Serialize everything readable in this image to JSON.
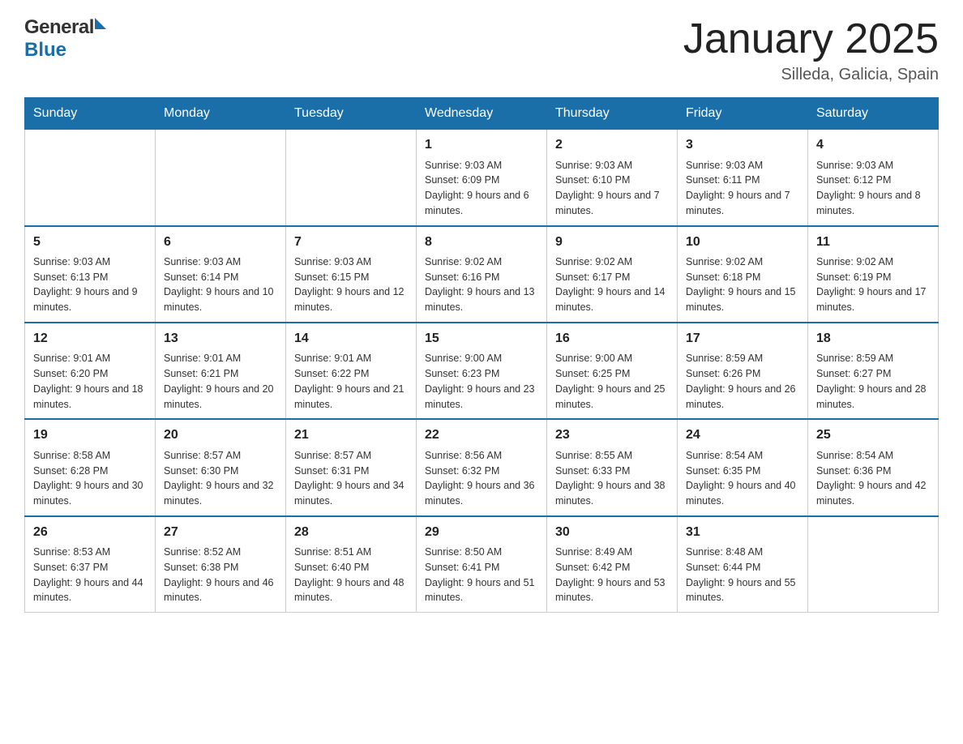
{
  "header": {
    "logo_general": "General",
    "logo_blue": "Blue",
    "month_title": "January 2025",
    "location": "Silleda, Galicia, Spain"
  },
  "days_of_week": [
    "Sunday",
    "Monday",
    "Tuesday",
    "Wednesday",
    "Thursday",
    "Friday",
    "Saturday"
  ],
  "weeks": [
    [
      {
        "day": "",
        "info": ""
      },
      {
        "day": "",
        "info": ""
      },
      {
        "day": "",
        "info": ""
      },
      {
        "day": "1",
        "info": "Sunrise: 9:03 AM\nSunset: 6:09 PM\nDaylight: 9 hours and 6 minutes."
      },
      {
        "day": "2",
        "info": "Sunrise: 9:03 AM\nSunset: 6:10 PM\nDaylight: 9 hours and 7 minutes."
      },
      {
        "day": "3",
        "info": "Sunrise: 9:03 AM\nSunset: 6:11 PM\nDaylight: 9 hours and 7 minutes."
      },
      {
        "day": "4",
        "info": "Sunrise: 9:03 AM\nSunset: 6:12 PM\nDaylight: 9 hours and 8 minutes."
      }
    ],
    [
      {
        "day": "5",
        "info": "Sunrise: 9:03 AM\nSunset: 6:13 PM\nDaylight: 9 hours and 9 minutes."
      },
      {
        "day": "6",
        "info": "Sunrise: 9:03 AM\nSunset: 6:14 PM\nDaylight: 9 hours and 10 minutes."
      },
      {
        "day": "7",
        "info": "Sunrise: 9:03 AM\nSunset: 6:15 PM\nDaylight: 9 hours and 12 minutes."
      },
      {
        "day": "8",
        "info": "Sunrise: 9:02 AM\nSunset: 6:16 PM\nDaylight: 9 hours and 13 minutes."
      },
      {
        "day": "9",
        "info": "Sunrise: 9:02 AM\nSunset: 6:17 PM\nDaylight: 9 hours and 14 minutes."
      },
      {
        "day": "10",
        "info": "Sunrise: 9:02 AM\nSunset: 6:18 PM\nDaylight: 9 hours and 15 minutes."
      },
      {
        "day": "11",
        "info": "Sunrise: 9:02 AM\nSunset: 6:19 PM\nDaylight: 9 hours and 17 minutes."
      }
    ],
    [
      {
        "day": "12",
        "info": "Sunrise: 9:01 AM\nSunset: 6:20 PM\nDaylight: 9 hours and 18 minutes."
      },
      {
        "day": "13",
        "info": "Sunrise: 9:01 AM\nSunset: 6:21 PM\nDaylight: 9 hours and 20 minutes."
      },
      {
        "day": "14",
        "info": "Sunrise: 9:01 AM\nSunset: 6:22 PM\nDaylight: 9 hours and 21 minutes."
      },
      {
        "day": "15",
        "info": "Sunrise: 9:00 AM\nSunset: 6:23 PM\nDaylight: 9 hours and 23 minutes."
      },
      {
        "day": "16",
        "info": "Sunrise: 9:00 AM\nSunset: 6:25 PM\nDaylight: 9 hours and 25 minutes."
      },
      {
        "day": "17",
        "info": "Sunrise: 8:59 AM\nSunset: 6:26 PM\nDaylight: 9 hours and 26 minutes."
      },
      {
        "day": "18",
        "info": "Sunrise: 8:59 AM\nSunset: 6:27 PM\nDaylight: 9 hours and 28 minutes."
      }
    ],
    [
      {
        "day": "19",
        "info": "Sunrise: 8:58 AM\nSunset: 6:28 PM\nDaylight: 9 hours and 30 minutes."
      },
      {
        "day": "20",
        "info": "Sunrise: 8:57 AM\nSunset: 6:30 PM\nDaylight: 9 hours and 32 minutes."
      },
      {
        "day": "21",
        "info": "Sunrise: 8:57 AM\nSunset: 6:31 PM\nDaylight: 9 hours and 34 minutes."
      },
      {
        "day": "22",
        "info": "Sunrise: 8:56 AM\nSunset: 6:32 PM\nDaylight: 9 hours and 36 minutes."
      },
      {
        "day": "23",
        "info": "Sunrise: 8:55 AM\nSunset: 6:33 PM\nDaylight: 9 hours and 38 minutes."
      },
      {
        "day": "24",
        "info": "Sunrise: 8:54 AM\nSunset: 6:35 PM\nDaylight: 9 hours and 40 minutes."
      },
      {
        "day": "25",
        "info": "Sunrise: 8:54 AM\nSunset: 6:36 PM\nDaylight: 9 hours and 42 minutes."
      }
    ],
    [
      {
        "day": "26",
        "info": "Sunrise: 8:53 AM\nSunset: 6:37 PM\nDaylight: 9 hours and 44 minutes."
      },
      {
        "day": "27",
        "info": "Sunrise: 8:52 AM\nSunset: 6:38 PM\nDaylight: 9 hours and 46 minutes."
      },
      {
        "day": "28",
        "info": "Sunrise: 8:51 AM\nSunset: 6:40 PM\nDaylight: 9 hours and 48 minutes."
      },
      {
        "day": "29",
        "info": "Sunrise: 8:50 AM\nSunset: 6:41 PM\nDaylight: 9 hours and 51 minutes."
      },
      {
        "day": "30",
        "info": "Sunrise: 8:49 AM\nSunset: 6:42 PM\nDaylight: 9 hours and 53 minutes."
      },
      {
        "day": "31",
        "info": "Sunrise: 8:48 AM\nSunset: 6:44 PM\nDaylight: 9 hours and 55 minutes."
      },
      {
        "day": "",
        "info": ""
      }
    ]
  ]
}
